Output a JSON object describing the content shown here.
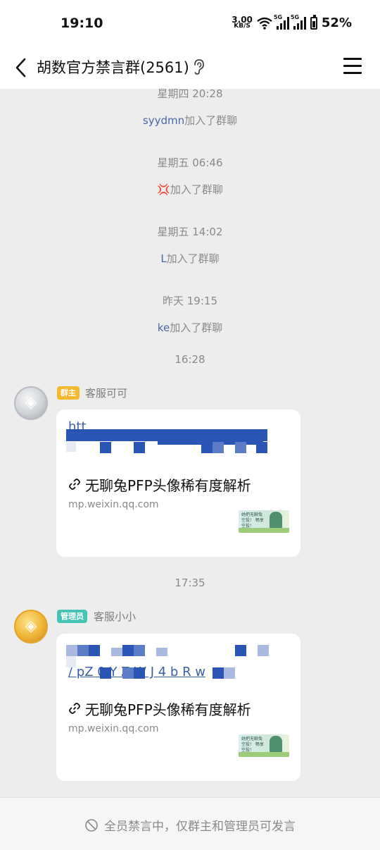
{
  "status_bar": {
    "time": "19:10",
    "net_speed_value": "3.00",
    "net_speed_unit": "KB/S",
    "sim1_tag": "5G",
    "sim2_tag": "5G",
    "battery": "52%"
  },
  "nav": {
    "title": "胡数官方禁言群(2561)",
    "back_icon": "chevron-left-icon",
    "ear_icon": "ear-icon",
    "menu_icon": "hamburger-menu-icon"
  },
  "system_events": [
    {
      "time": "星期四 20:28",
      "who": "syydmn",
      "action": "加入了群聊"
    },
    {
      "time": "星期五 06:46",
      "who": "💢",
      "action": "加入了群聊"
    },
    {
      "time": "星期五 14:02",
      "who": "L",
      "action": "加入了群聊"
    },
    {
      "time": "昨天 19:15",
      "who": "ke",
      "action": "加入了群聊"
    }
  ],
  "messages": [
    {
      "time": "16:28",
      "role_badge": "群主",
      "sender": "客服可可",
      "avatar_color": "#C9CDD2",
      "link_line1": "htt",
      "link_line2": "",
      "card_title": "无聊兔PFP头像稀有度解析",
      "card_domain": "mp.weixin.qq.com"
    },
    {
      "time": "17:35",
      "role_badge": "管理员",
      "sender": "客服小小",
      "avatar_color": "#F0B437",
      "link_line1": "",
      "link_line2": "/                       pZ 0 Y Z W J 4 b R w",
      "card_title": "无聊兔PFP头像稀有度解析",
      "card_domain": "mp.weixin.qq.com"
    }
  ],
  "thumbnail": {
    "caption": "她把无聊兔空投！ 畅享空投！"
  },
  "bottom": {
    "mute_notice": "全员禁言中，仅群主和管理员可发言",
    "mute_icon": "no-speaking-icon"
  },
  "colors": {
    "owner_badge": "#F5B82E",
    "admin_badge": "#45C4B5",
    "link": "#3C5FA8",
    "system_name": "#4A67A8",
    "mosaic": "#2B55B5"
  }
}
